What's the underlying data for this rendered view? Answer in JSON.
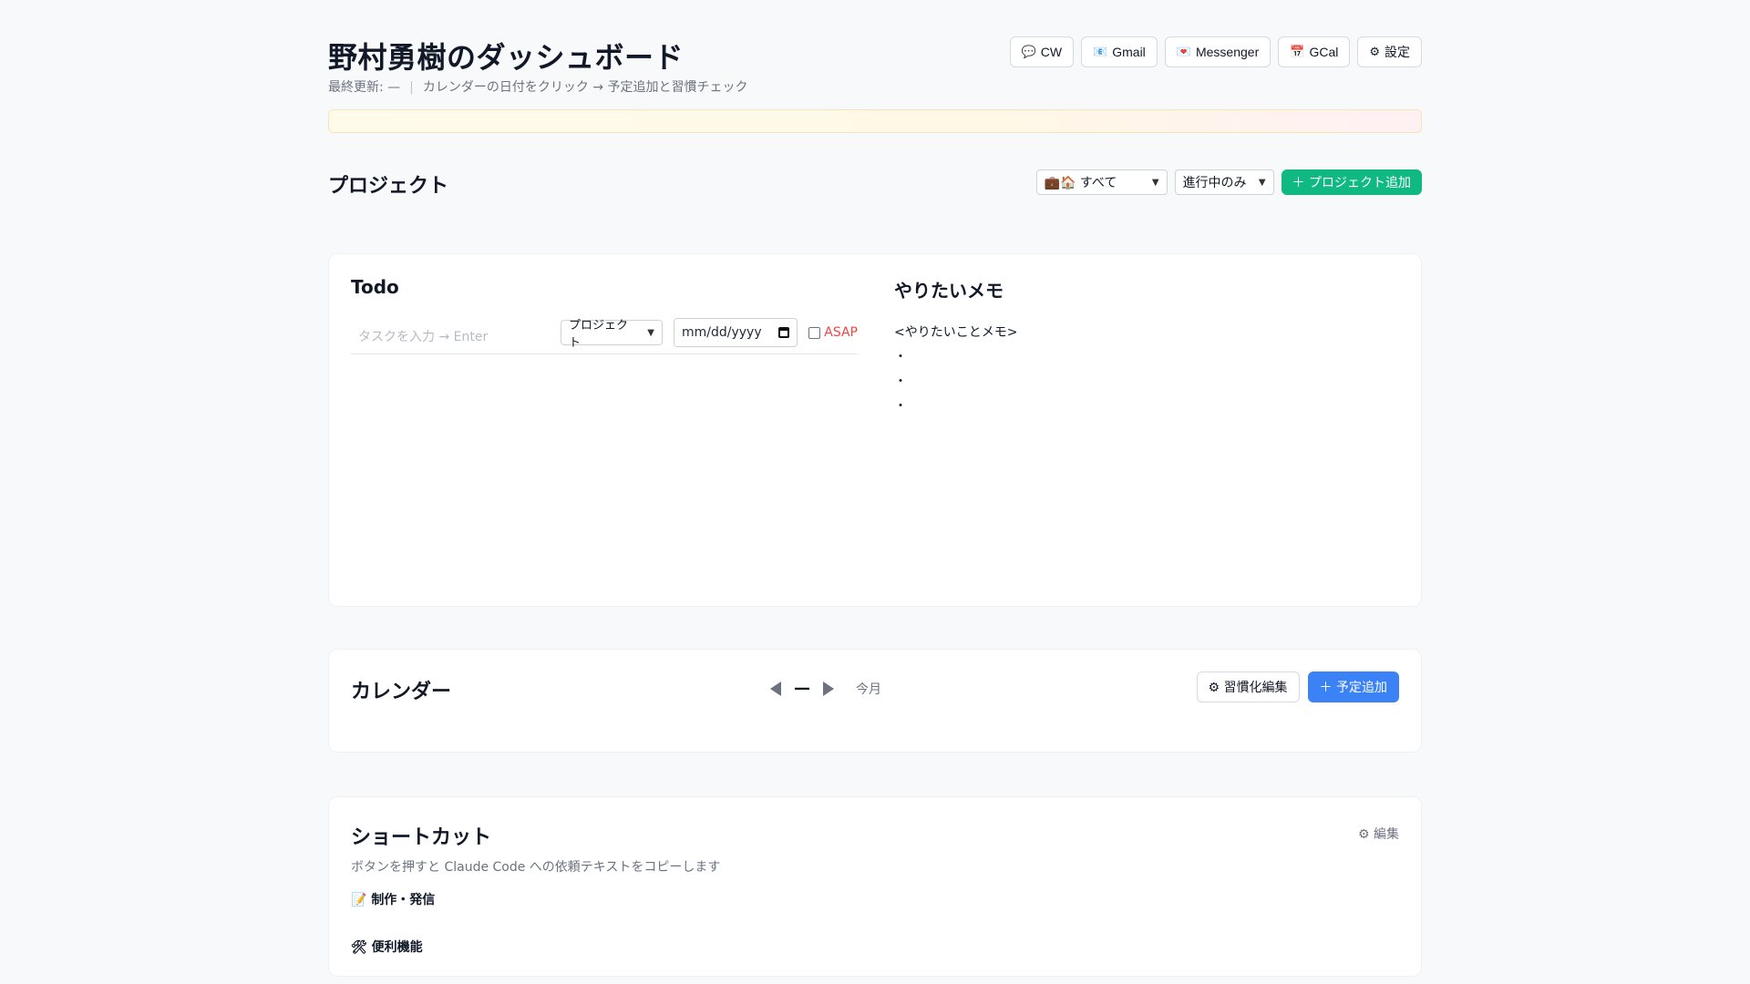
{
  "header": {
    "title": "野村勇樹のダッシュボード",
    "last_updated": "最終更新: —",
    "hint": "カレンダーの日付をクリック → 予定追加と習慣チェック",
    "links": [
      {
        "icon": "💬",
        "label": "CW"
      },
      {
        "icon": "📧",
        "label": "Gmail"
      },
      {
        "icon": "💌",
        "label": "Messenger"
      },
      {
        "icon": "📅",
        "label": "GCal"
      },
      {
        "icon": "⚙",
        "label": "設定"
      }
    ]
  },
  "projects": {
    "title": "プロジェクト",
    "filter_category": "💼🏠 すべて",
    "filter_status": "進行中のみ",
    "add_button": "＋ プロジェクト追加"
  },
  "todo": {
    "title": "Todo",
    "task_placeholder": "タスクを入力 → Enter",
    "project_select": "プロジェクト",
    "date_placeholder": "mm/dd/yyyy",
    "asap_label": "ASAP"
  },
  "memo": {
    "title": "やりたいメモ",
    "content": "<やりたいことメモ>\n・\n・\n・"
  },
  "calendar": {
    "title": "カレンダー",
    "month_label": "—",
    "today_label": "今月",
    "habit_edit": "⚙ 習慣化編集",
    "add_event": "＋ 予定追加"
  },
  "shortcuts": {
    "title": "ショートカット",
    "description": "ボタンを押すと Claude Code への依頼テキストをコピーします",
    "edit": "⚙ 編集",
    "groups": [
      {
        "icon": "📝",
        "label": "制作・発信"
      },
      {
        "icon": "🛠",
        "label": "便利機能"
      }
    ]
  },
  "colors": {
    "accent_green": "#10b981",
    "accent_blue": "#3b82f6",
    "asap_red": "#ef4444"
  }
}
